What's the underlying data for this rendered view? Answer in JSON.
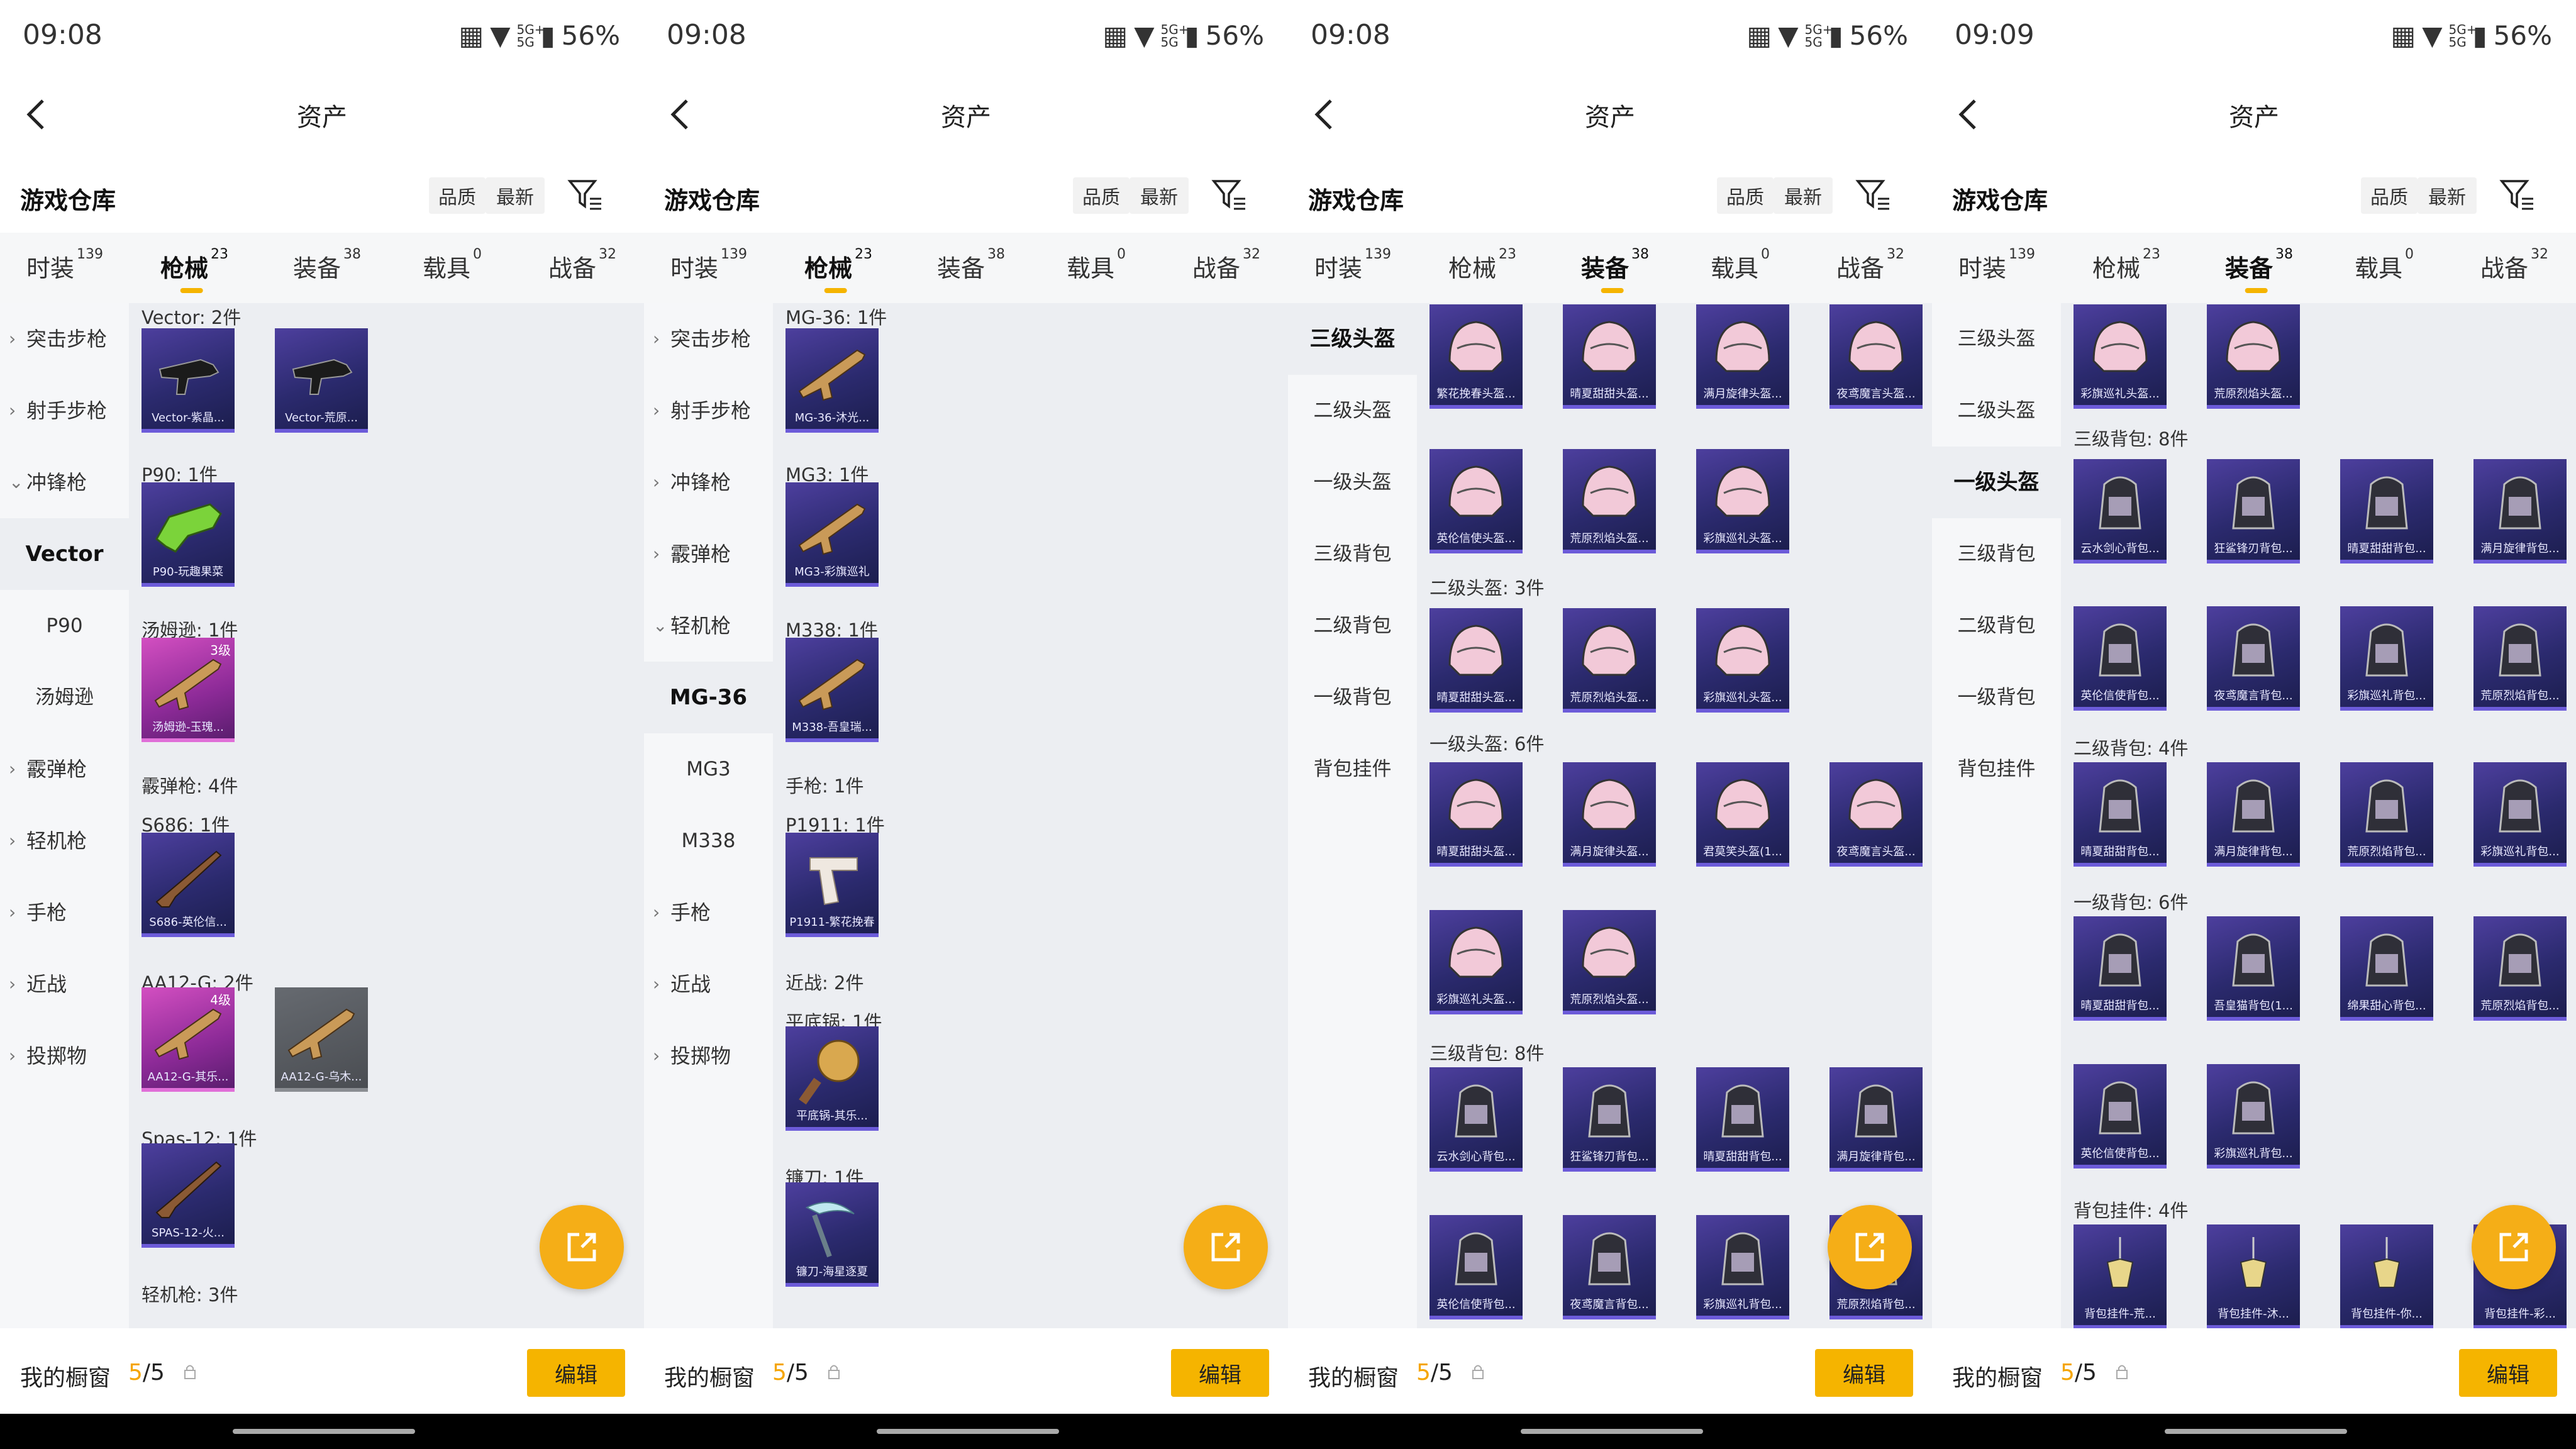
{
  "common": {
    "nav_title": "资产",
    "warehouse_title": "游戏仓库",
    "sort_quality": "品质",
    "sort_latest": "最新",
    "bottom_label": "我的橱窗",
    "bottom_count_current": "5",
    "bottom_count_total": "/5",
    "edit_label": "编辑",
    "signal": "5G+ 5G",
    "battery": "56%",
    "accent_color": "#f5b400"
  },
  "tabs": [
    {
      "label": "时装",
      "count": "139"
    },
    {
      "label": "枪械",
      "count": "23"
    },
    {
      "label": "装备",
      "count": "38"
    },
    {
      "label": "载具",
      "count": "0"
    },
    {
      "label": "战备",
      "count": "32"
    }
  ],
  "panels": [
    {
      "time": "09:08",
      "active_tab": 1,
      "sidebar": [
        {
          "label": "突击步枪",
          "arrow": "›"
        },
        {
          "label": "射手步枪",
          "arrow": "›"
        },
        {
          "label": "冲锋枪",
          "arrow": "⌄"
        },
        {
          "label": "Vector",
          "selected": true
        },
        {
          "label": "P90",
          "sub": true
        },
        {
          "label": "汤姆逊",
          "sub": true
        },
        {
          "label": "霰弹枪",
          "arrow": "›"
        },
        {
          "label": "轻机枪",
          "arrow": "›"
        },
        {
          "label": "手枪",
          "arrow": "›"
        },
        {
          "label": "近战",
          "arrow": "›"
        },
        {
          "label": "投掷物",
          "arrow": "›"
        }
      ],
      "groups": [
        {
          "title": "Vector: 2件",
          "items": [
            {
              "name": "Vector-紫晶...",
              "icon": "smg-icon"
            },
            {
              "name": "Vector-荒原...",
              "icon": "smg-icon"
            }
          ]
        },
        {
          "title": "P90: 1件",
          "items": [
            {
              "name": "P90-玩趣果菜",
              "icon": "p90-icon"
            }
          ]
        },
        {
          "title": "汤姆逊: 1件",
          "items": [
            {
              "name": "汤姆逊-玉瑰...",
              "icon": "rifle-icon",
              "level": "3级",
              "rarity": "pink"
            }
          ]
        },
        {
          "title": "霰弹枪: 4件",
          "items": []
        },
        {
          "title": "S686: 1件",
          "items": [
            {
              "name": "S686-英伦信...",
              "icon": "shotgun-icon"
            }
          ]
        },
        {
          "title": "AA12-G: 2件",
          "items": [
            {
              "name": "AA12-G-其乐...",
              "icon": "rifle-icon",
              "level": "4级",
              "rarity": "pink"
            },
            {
              "name": "AA12-G-乌木...",
              "icon": "rifle-icon",
              "rarity": "gray"
            }
          ]
        },
        {
          "title": "Spas-12: 1件",
          "items": [
            {
              "name": "SPAS-12-火...",
              "icon": "shotgun-icon"
            }
          ]
        },
        {
          "title": "轻机枪: 3件",
          "items": []
        }
      ]
    },
    {
      "time": "09:08",
      "active_tab": 1,
      "sidebar": [
        {
          "label": "突击步枪",
          "arrow": "›"
        },
        {
          "label": "射手步枪",
          "arrow": "›"
        },
        {
          "label": "冲锋枪",
          "arrow": "›"
        },
        {
          "label": "霰弹枪",
          "arrow": "›"
        },
        {
          "label": "轻机枪",
          "arrow": "⌄"
        },
        {
          "label": "MG-36",
          "selected": true
        },
        {
          "label": "MG3",
          "sub": true
        },
        {
          "label": "M338",
          "sub": true
        },
        {
          "label": "手枪",
          "arrow": "›"
        },
        {
          "label": "近战",
          "arrow": "›"
        },
        {
          "label": "投掷物",
          "arrow": "›"
        }
      ],
      "groups": [
        {
          "title": "MG-36: 1件",
          "items": [
            {
              "name": "MG-36-沐光...",
              "icon": "rifle-icon"
            }
          ]
        },
        {
          "title": "MG3: 1件",
          "items": [
            {
              "name": "MG3-彩旗巡礼",
              "icon": "rifle-icon"
            }
          ]
        },
        {
          "title": "M338: 1件",
          "items": [
            {
              "name": "M338-吾皇瑞...",
              "icon": "rifle-icon"
            }
          ]
        },
        {
          "title": "手枪: 1件",
          "items": []
        },
        {
          "title": "P1911: 1件",
          "items": [
            {
              "name": "P1911-繁花挽春",
              "icon": "pistol-icon"
            }
          ]
        },
        {
          "title": "近战: 2件",
          "items": []
        },
        {
          "title": "平底锅: 1件",
          "items": [
            {
              "name": "平底锅-其乐...",
              "icon": "pan-icon"
            }
          ]
        },
        {
          "title": "镰刀: 1件",
          "items": [
            {
              "name": "镰刀-海星逐夏",
              "icon": "sickle-icon"
            }
          ]
        }
      ]
    },
    {
      "time": "09:08",
      "active_tab": 2,
      "sidebar": [
        {
          "label": "三级头盔",
          "selected": true
        },
        {
          "label": "二级头盔",
          "sub": true
        },
        {
          "label": "一级头盔",
          "sub": true
        },
        {
          "label": "三级背包",
          "sub": true
        },
        {
          "label": "二级背包",
          "sub": true
        },
        {
          "label": "一级背包",
          "sub": true
        },
        {
          "label": "背包挂件",
          "sub": true
        }
      ],
      "groups": [
        {
          "title": "",
          "items": [
            {
              "name": "繁花挽春头盔...",
              "icon": "helmet-icon"
            },
            {
              "name": "晴夏甜甜头盔...",
              "icon": "helmet-icon"
            },
            {
              "name": "满月旋律头盔...",
              "icon": "helmet-icon"
            },
            {
              "name": "夜鸢魔言头盔...",
              "icon": "helmet-icon"
            },
            {
              "name": "英伦信使头盔...",
              "icon": "helmet-icon"
            },
            {
              "name": "荒原烈焰头盔...",
              "icon": "helmet-icon"
            },
            {
              "name": "彩旗巡礼头盔...",
              "icon": "helmet-icon"
            }
          ]
        },
        {
          "title": "二级头盔: 3件",
          "items": [
            {
              "name": "晴夏甜甜头盔...",
              "icon": "helmet-icon"
            },
            {
              "name": "荒原烈焰头盔...",
              "icon": "helmet-icon"
            },
            {
              "name": "彩旗巡礼头盔...",
              "icon": "helmet-icon"
            }
          ]
        },
        {
          "title": "一级头盔: 6件",
          "items": [
            {
              "name": "晴夏甜甜头盔...",
              "icon": "helmet-icon"
            },
            {
              "name": "满月旋律头盔...",
              "icon": "helmet-icon"
            },
            {
              "name": "君莫笑头盔(1...",
              "icon": "helmet-icon"
            },
            {
              "name": "夜鸢魔言头盔...",
              "icon": "helmet-icon"
            },
            {
              "name": "彩旗巡礼头盔...",
              "icon": "helmet-icon"
            },
            {
              "name": "荒原烈焰头盔...",
              "icon": "helmet-icon"
            }
          ]
        },
        {
          "title": "三级背包: 8件",
          "items": [
            {
              "name": "云水剑心背包...",
              "icon": "backpack-icon"
            },
            {
              "name": "狂鲨锋刃背包...",
              "icon": "backpack-icon"
            },
            {
              "name": "晴夏甜甜背包...",
              "icon": "backpack-icon"
            },
            {
              "name": "满月旋律背包...",
              "icon": "backpack-icon"
            },
            {
              "name": "英伦信使背包...",
              "icon": "backpack-icon"
            },
            {
              "name": "夜鸢魔言背包...",
              "icon": "backpack-icon"
            },
            {
              "name": "彩旗巡礼背包...",
              "icon": "backpack-icon"
            },
            {
              "name": "荒原烈焰背包...",
              "icon": "backpack-icon"
            }
          ]
        }
      ]
    },
    {
      "time": "09:09",
      "active_tab": 2,
      "sidebar": [
        {
          "label": "三级头盔",
          "sub": true
        },
        {
          "label": "二级头盔",
          "sub": true
        },
        {
          "label": "一级头盔",
          "selected": true
        },
        {
          "label": "三级背包",
          "sub": true
        },
        {
          "label": "二级背包",
          "sub": true
        },
        {
          "label": "一级背包",
          "sub": true
        },
        {
          "label": "背包挂件",
          "sub": true
        }
      ],
      "groups": [
        {
          "title": "",
          "items": [
            {
              "name": "彩旗巡礼头盔...",
              "icon": "helmet-icon"
            },
            {
              "name": "荒原烈焰头盔...",
              "icon": "helmet-icon"
            }
          ]
        },
        {
          "title": "三级背包: 8件",
          "items": [
            {
              "name": "云水剑心背包...",
              "icon": "backpack-icon"
            },
            {
              "name": "狂鲨锋刃背包...",
              "icon": "backpack-icon"
            },
            {
              "name": "晴夏甜甜背包...",
              "icon": "backpack-icon"
            },
            {
              "name": "满月旋律背包...",
              "icon": "backpack-icon"
            },
            {
              "name": "英伦信使背包...",
              "icon": "backpack-icon"
            },
            {
              "name": "夜鸢魔言背包...",
              "icon": "backpack-icon"
            },
            {
              "name": "彩旗巡礼背包...",
              "icon": "backpack-icon"
            },
            {
              "name": "荒原烈焰背包...",
              "icon": "backpack-icon"
            }
          ]
        },
        {
          "title": "二级背包: 4件",
          "items": [
            {
              "name": "晴夏甜甜背包...",
              "icon": "backpack-icon"
            },
            {
              "name": "满月旋律背包...",
              "icon": "backpack-icon"
            },
            {
              "name": "荒原烈焰背包...",
              "icon": "backpack-icon"
            },
            {
              "name": "彩旗巡礼背包...",
              "icon": "backpack-icon"
            }
          ]
        },
        {
          "title": "一级背包: 6件",
          "items": [
            {
              "name": "晴夏甜甜背包...",
              "icon": "backpack-icon"
            },
            {
              "name": "吾皇猫背包(1...",
              "icon": "backpack-icon"
            },
            {
              "name": "绵果甜心背包...",
              "icon": "backpack-icon"
            },
            {
              "name": "荒原烈焰背包...",
              "icon": "backpack-icon"
            },
            {
              "name": "英伦信使背包...",
              "icon": "backpack-icon"
            },
            {
              "name": "彩旗巡礼背包...",
              "icon": "backpack-icon"
            }
          ]
        },
        {
          "title": "背包挂件: 4件",
          "items": [
            {
              "name": "背包挂件-荒...",
              "icon": "charm-icon"
            },
            {
              "name": "背包挂件-沐...",
              "icon": "charm-icon"
            },
            {
              "name": "背包挂件-你...",
              "icon": "charm-icon"
            },
            {
              "name": "背包挂件-彩...",
              "icon": "charm-icon"
            }
          ]
        }
      ]
    }
  ]
}
